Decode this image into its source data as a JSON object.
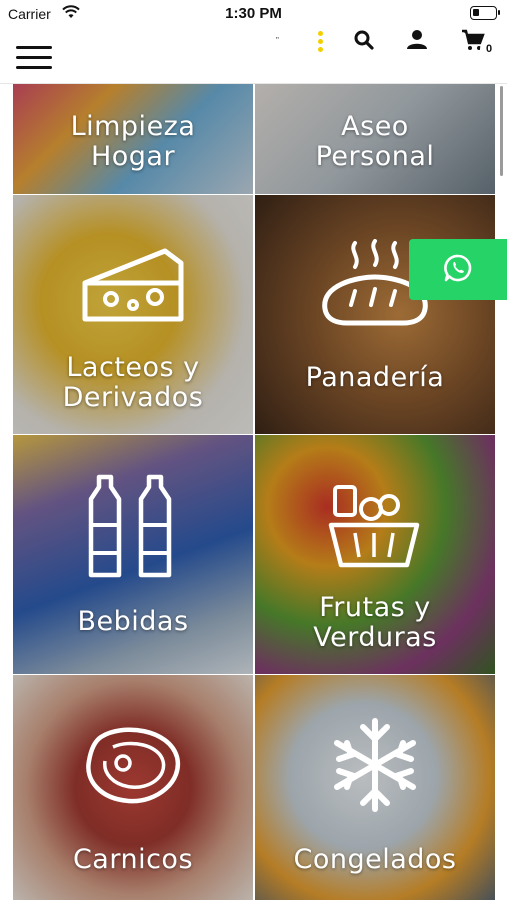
{
  "status_bar": {
    "carrier": "Carrier",
    "time": "1:30 PM"
  },
  "header": {
    "logo_text": "\"",
    "cart_count": "0"
  },
  "categories": [
    {
      "label_line1": "Limpieza",
      "label_line2": "Hogar"
    },
    {
      "label_line1": "Aseo",
      "label_line2": "Personal"
    },
    {
      "label_line1": "Lacteos y",
      "label_line2": "Derivados"
    },
    {
      "label_line1": "Panadería",
      "label_line2": ""
    },
    {
      "label_line1": "Bebidas",
      "label_line2": ""
    },
    {
      "label_line1": "Frutas y",
      "label_line2": "Verduras"
    },
    {
      "label_line1": "Carnicos",
      "label_line2": ""
    },
    {
      "label_line1": "Congelados",
      "label_line2": ""
    }
  ],
  "icons": {
    "menu": "hamburger-icon",
    "search": "search-icon",
    "user": "user-icon",
    "cart": "cart-icon",
    "whatsapp": "whatsapp-icon"
  },
  "colors": {
    "whatsapp": "#25d366",
    "accent_dots": "#f2cf00"
  }
}
